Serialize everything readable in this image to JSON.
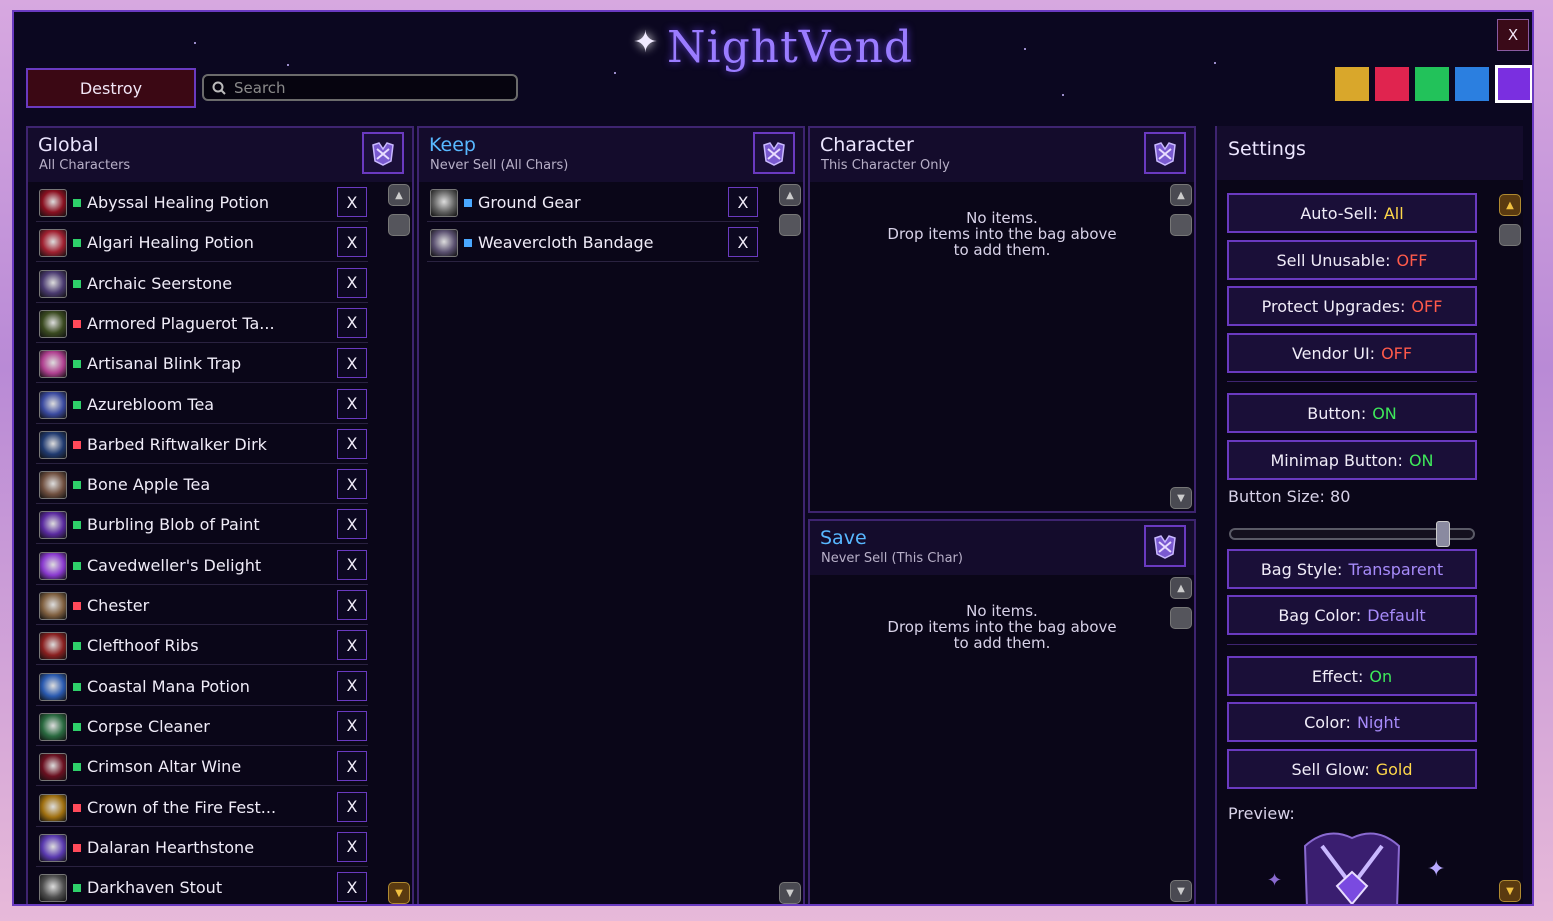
{
  "app": {
    "title": "NightVend",
    "close_label": "X"
  },
  "toolbar": {
    "destroy_label": "Destroy",
    "search_placeholder": "Search"
  },
  "colors": {
    "swatches": [
      "#d9a72b",
      "#e0244f",
      "#22c25a",
      "#2b7fe0",
      "#7a2fe0"
    ],
    "selected_swatch": "#7a2fe0",
    "rarity": {
      "common": "#2ed06a",
      "rare": "#ff4a5a",
      "blue": "#4aa8ff"
    }
  },
  "global": {
    "title": "Global",
    "subtitle": "All Characters",
    "items": [
      {
        "name": "Abyssal Healing Potion",
        "rarity": "common",
        "icon": "red-potion-icon"
      },
      {
        "name": "Algari Healing Potion",
        "rarity": "common",
        "icon": "red-flask-icon"
      },
      {
        "name": "Archaic Seerstone",
        "rarity": "common",
        "icon": "stone-icon"
      },
      {
        "name": "Armored Plaguerot Ta...",
        "rarity": "rare",
        "icon": "armor-icon"
      },
      {
        "name": "Artisanal Blink Trap",
        "rarity": "common",
        "icon": "trap-icon"
      },
      {
        "name": "Azurebloom Tea",
        "rarity": "common",
        "icon": "tea-icon"
      },
      {
        "name": "Barbed Riftwalker Dirk",
        "rarity": "rare",
        "icon": "dagger-icon"
      },
      {
        "name": "Bone Apple Tea",
        "rarity": "common",
        "icon": "apple-icon"
      },
      {
        "name": "Burbling Blob of Paint",
        "rarity": "common",
        "icon": "paint-icon"
      },
      {
        "name": "Cavedweller's Delight",
        "rarity": "common",
        "icon": "vial-icon"
      },
      {
        "name": "Chester",
        "rarity": "rare",
        "icon": "pet-icon"
      },
      {
        "name": "Clefthoof Ribs",
        "rarity": "common",
        "icon": "meat-icon"
      },
      {
        "name": "Coastal Mana Potion",
        "rarity": "common",
        "icon": "blue-potion-icon"
      },
      {
        "name": "Corpse Cleaner",
        "rarity": "common",
        "icon": "cleaner-icon"
      },
      {
        "name": "Crimson Altar Wine",
        "rarity": "common",
        "icon": "wine-icon"
      },
      {
        "name": "Crown of the Fire Fest...",
        "rarity": "rare",
        "icon": "crown-icon"
      },
      {
        "name": "Dalaran Hearthstone",
        "rarity": "rare",
        "icon": "hearthstone-icon"
      },
      {
        "name": "Darkhaven Stout",
        "rarity": "common",
        "icon": "mug-icon"
      }
    ],
    "remove_label": "X"
  },
  "keep": {
    "title": "Keep",
    "subtitle": "Never Sell (All Chars)",
    "items": [
      {
        "name": "Ground Gear",
        "rarity": "blue",
        "icon": "gear-item-icon"
      },
      {
        "name": "Weavercloth Bandage",
        "rarity": "blue",
        "icon": "bandage-icon"
      }
    ],
    "remove_label": "X"
  },
  "character": {
    "title": "Character",
    "subtitle": "This Character Only",
    "empty_line1": "No items.",
    "empty_line2": "Drop items into the bag above",
    "empty_line3": "to add them."
  },
  "save": {
    "title": "Save",
    "subtitle": "Never Sell (This Char)",
    "empty_line1": "No items.",
    "empty_line2": "Drop items into the bag above",
    "empty_line3": "to add them."
  },
  "settings": {
    "title": "Settings",
    "auto_sell": {
      "label": "Auto-Sell:",
      "value": "All"
    },
    "sell_unusable": {
      "label": "Sell Unusable:",
      "value": "OFF"
    },
    "protect_upgrades": {
      "label": "Protect Upgrades:",
      "value": "OFF"
    },
    "vendor_ui": {
      "label": "Vendor UI:",
      "value": "OFF"
    },
    "button": {
      "label": "Button:",
      "value": "ON"
    },
    "minimap_button": {
      "label": "Minimap Button:",
      "value": "ON"
    },
    "button_size": {
      "label": "Button Size:",
      "value": "80",
      "slider_fraction": 0.9
    },
    "bag_style": {
      "label": "Bag Style:",
      "value": "Transparent"
    },
    "bag_color": {
      "label": "Bag Color:",
      "value": "Default"
    },
    "effect": {
      "label": "Effect:",
      "value": "On"
    },
    "color": {
      "label": "Color:",
      "value": "Night"
    },
    "sell_glow": {
      "label": "Sell Glow:",
      "value": "Gold"
    },
    "preview_label": "Preview:"
  }
}
